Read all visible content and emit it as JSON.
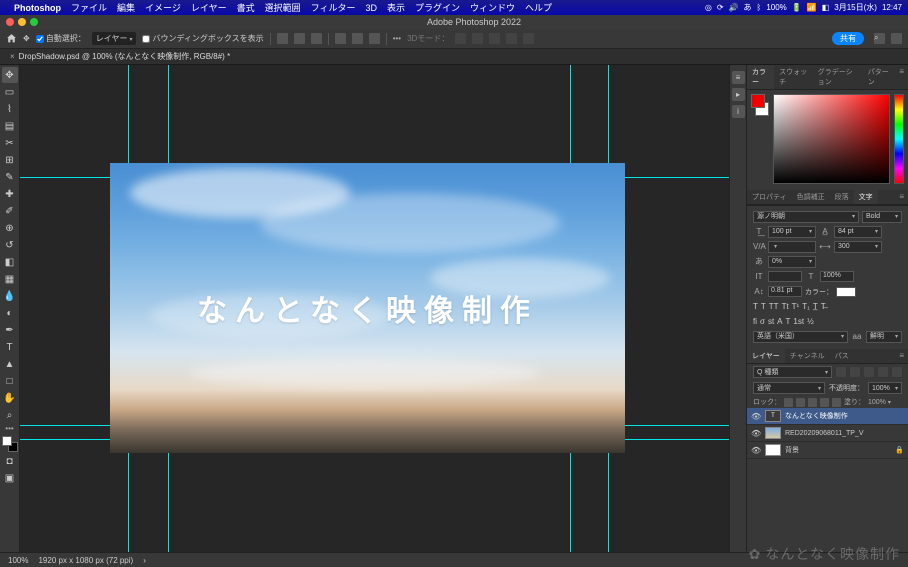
{
  "menubar": {
    "app": "Photoshop",
    "items": [
      "ファイル",
      "編集",
      "イメージ",
      "レイヤー",
      "書式",
      "選択範囲",
      "フィルター",
      "3D",
      "表示",
      "プラグイン",
      "ウィンドウ",
      "ヘルプ"
    ],
    "status_battery": "100%",
    "status_ime": "あ",
    "status_date": "3月15日(水)",
    "status_time": "12:47"
  },
  "window": {
    "title": "Adobe Photoshop 2022"
  },
  "options": {
    "auto_select_label": "自動選択：",
    "auto_select_target": "レイヤー",
    "bbox_label": "バウンディングボックスを表示",
    "mode3d_label": "3Dモード：",
    "share": "共有"
  },
  "doc_tab": {
    "title": "DropShadow.psd @ 100% (なんとなく映像制作, RGB/8#) *"
  },
  "canvas": {
    "hero_text": "なんとなく映像制作"
  },
  "color_tabs": [
    "カラー",
    "スウォッチ",
    "グラデーション",
    "パターン"
  ],
  "prop_tabs": [
    "プロパティ",
    "色調補正",
    "段落",
    "文字"
  ],
  "char": {
    "font": "源ノ明朝",
    "weight": "Bold",
    "size": "100 pt",
    "leading": "84 pt",
    "tracking": "300",
    "kerning_pct": "0%",
    "vscale": "100%",
    "baseline": "0.81 pt",
    "color_label": "カラー：",
    "lang": "英語（米国）",
    "aa": "鮮明"
  },
  "layer_tabs": [
    "レイヤー",
    "チャンネル",
    "パス"
  ],
  "layers": {
    "filter": "Q 種類",
    "blend": "通常",
    "opacity_label": "不透明度：",
    "opacity": "100%",
    "lock_label": "ロック：",
    "fill_label": "塗り：",
    "fill": "100%",
    "items": [
      {
        "name": "なんとなく映像制作",
        "kind": "T",
        "selected": true
      },
      {
        "name": "RED20209068011_TP_V",
        "kind": "img",
        "selected": false
      },
      {
        "name": "背景",
        "kind": "bg",
        "selected": false
      }
    ]
  },
  "status": {
    "zoom": "100%",
    "dims": "1920 px x 1080 px (72 ppi)"
  },
  "watermark": "なんとなく映像制作"
}
